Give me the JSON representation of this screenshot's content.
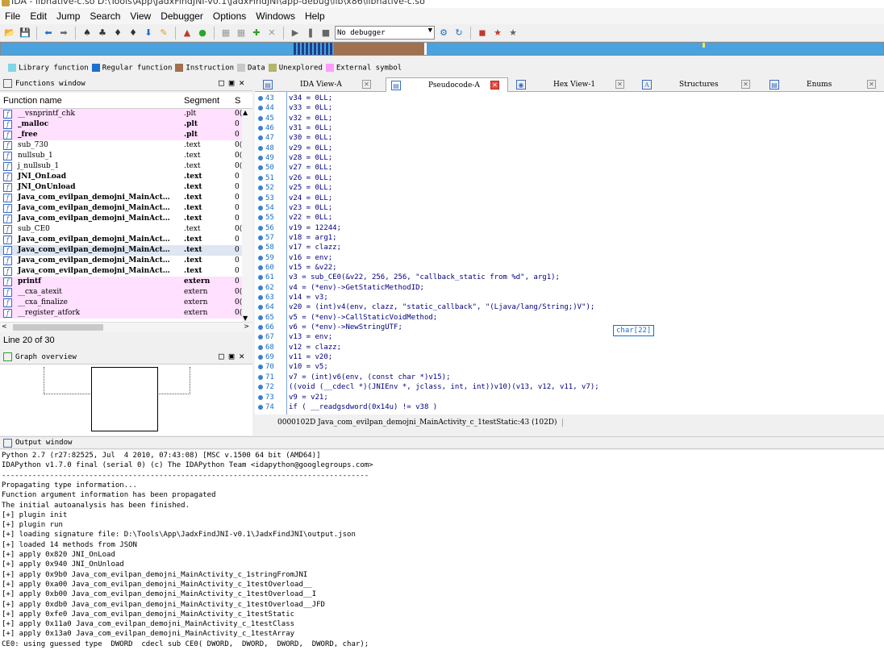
{
  "window": {
    "title": "IDA - libnative-c.so D:\\Tools\\App\\JadxFindJNI-v0.1\\JadxFindJNI\\app-debug\\lib\\x86\\libnative-c.so"
  },
  "menu": [
    "File",
    "Edit",
    "Jump",
    "Search",
    "View",
    "Debugger",
    "Options",
    "Windows",
    "Help"
  ],
  "toolbar": {
    "debugger_select": "No debugger"
  },
  "legend": [
    {
      "label": "Library function",
      "color": "#7fd6e6"
    },
    {
      "label": "Regular function",
      "color": "#1f6fd1"
    },
    {
      "label": "Instruction",
      "color": "#a0704f"
    },
    {
      "label": "Data",
      "color": "#c8c8c8"
    },
    {
      "label": "Unexplored",
      "color": "#b5b56b"
    },
    {
      "label": "External symbol",
      "color": "#ff9cff"
    }
  ],
  "functions_window": {
    "title": "Functions window",
    "col_name": "Function name",
    "col_segment": "Segment",
    "col_s": "S",
    "line_label": "Line 20 of 30",
    "rows": [
      {
        "name": "__vsnprintf_chk",
        "segment": ".plt",
        "s": "0(",
        "style": "pink"
      },
      {
        "name": "_malloc",
        "segment": ".plt",
        "s": "0",
        "style": "pink bold"
      },
      {
        "name": "_free",
        "segment": ".plt",
        "s": "0",
        "style": "pink bold"
      },
      {
        "name": "sub_730",
        "segment": ".text",
        "s": "0(",
        "style": ""
      },
      {
        "name": "nullsub_1",
        "segment": ".text",
        "s": "0(",
        "style": ""
      },
      {
        "name": "j_nullsub_1",
        "segment": ".text",
        "s": "0(",
        "style": ""
      },
      {
        "name": "JNI_OnLoad",
        "segment": ".text",
        "s": "0",
        "style": "bold"
      },
      {
        "name": "JNI_OnUnload",
        "segment": ".text",
        "s": "0",
        "style": "bold"
      },
      {
        "name": "Java_com_evilpan_demojni_MainAct…",
        "segment": ".text",
        "s": "0",
        "style": "bold"
      },
      {
        "name": "Java_com_evilpan_demojni_MainAct…",
        "segment": ".text",
        "s": "0",
        "style": "bold"
      },
      {
        "name": "Java_com_evilpan_demojni_MainAct…",
        "segment": ".text",
        "s": "0",
        "style": "bold"
      },
      {
        "name": "sub_CE0",
        "segment": ".text",
        "s": "0(",
        "style": ""
      },
      {
        "name": "Java_com_evilpan_demojni_MainAct…",
        "segment": ".text",
        "s": "0",
        "style": "bold"
      },
      {
        "name": "Java_com_evilpan_demojni_MainAct…",
        "segment": ".text",
        "s": "0",
        "style": "bold sel"
      },
      {
        "name": "Java_com_evilpan_demojni_MainAct…",
        "segment": ".text",
        "s": "0",
        "style": "bold"
      },
      {
        "name": "Java_com_evilpan_demojni_MainAct…",
        "segment": ".text",
        "s": "0",
        "style": "bold"
      },
      {
        "name": "printf",
        "segment": "extern",
        "s": "0",
        "style": "pink bold"
      },
      {
        "name": "__cxa_atexit",
        "segment": "extern",
        "s": "0(",
        "style": "pink"
      },
      {
        "name": "__cxa_finalize",
        "segment": "extern",
        "s": "0(",
        "style": "pink"
      },
      {
        "name": "__register_atfork",
        "segment": "extern",
        "s": "0(",
        "style": "pink"
      }
    ]
  },
  "graph_overview": {
    "title": "Graph overview"
  },
  "tabs": [
    {
      "label": "IDA View-A",
      "active": false,
      "close": "normal"
    },
    {
      "label": "Pseudocode-A",
      "active": true,
      "close": "red"
    },
    {
      "label": "Hex View-1",
      "active": false,
      "close": "normal"
    },
    {
      "label": "Structures",
      "active": false,
      "close": "normal"
    },
    {
      "label": "Enums",
      "active": false,
      "close": "normal"
    }
  ],
  "code_lines": [
    {
      "n": "43",
      "t": "v34 = 0LL;"
    },
    {
      "n": "44",
      "t": "v33 = 0LL;"
    },
    {
      "n": "45",
      "t": "v32 = 0LL;"
    },
    {
      "n": "46",
      "t": "v31 = 0LL;"
    },
    {
      "n": "47",
      "t": "v30 = 0LL;"
    },
    {
      "n": "48",
      "t": "v29 = 0LL;"
    },
    {
      "n": "49",
      "t": "v28 = 0LL;"
    },
    {
      "n": "50",
      "t": "v27 = 0LL;"
    },
    {
      "n": "51",
      "t": "v26 = 0LL;"
    },
    {
      "n": "52",
      "t": "v25 = 0LL;"
    },
    {
      "n": "53",
      "t": "v24 = 0LL;"
    },
    {
      "n": "54",
      "t": "v23 = 0LL;"
    },
    {
      "n": "55",
      "t": "v22 = 0LL;"
    },
    {
      "n": "56",
      "t": "v19 = 12244;"
    },
    {
      "n": "57",
      "t": "v18 = arg1;"
    },
    {
      "n": "58",
      "t": "v17 = clazz;"
    },
    {
      "n": "59",
      "t": "v16 = env;"
    },
    {
      "n": "60",
      "t": "v15 = &v22;"
    },
    {
      "n": "61",
      "t": "v3 = sub_CE0(&v22, 256, 256, \"callback_static from %d\", arg1);"
    },
    {
      "n": "62",
      "t": "v4 = (*env)->GetStaticMethodID;"
    },
    {
      "n": "63",
      "t": "v14 = v3;"
    },
    {
      "n": "64",
      "t": "v20 = (int)v4(env, clazz, \"static_callback\", \"(Ljava/lang/String;)V\");"
    },
    {
      "n": "65",
      "t": "v5 = (*env)->CallStaticVoidMethod;"
    },
    {
      "n": "66",
      "t": "v6 = (*env)->NewStringUTF;"
    },
    {
      "n": "67",
      "t": "v13 = env;"
    },
    {
      "n": "68",
      "t": "v12 = clazz;"
    },
    {
      "n": "69",
      "t": "v11 = v20;"
    },
    {
      "n": "70",
      "t": "v10 = v5;"
    },
    {
      "n": "71",
      "t": "v7 = (int)v6(env, (const char *)v15);"
    },
    {
      "n": "72",
      "t": "((void (__cdecl *)(JNIEnv *, jclass, int, int))v10)(v13, v12, v11, v7);"
    },
    {
      "n": "73",
      "t": "v9 = v21;"
    },
    {
      "n": "74",
      "t": "if ( __readgsdword(0x14u) != v38 )"
    }
  ],
  "hint_box": "char[22]",
  "status_line": "0000102D Java_com_evilpan_demojni_MainActivity_c_1testStatic:43 (102D)",
  "output_window": {
    "title": "Output window",
    "lines": [
      "Python 2.7 (r27:82525, Jul  4 2010, 07:43:08) [MSC v.1500 64 bit (AMD64)]",
      "IDAPython v1.7.0 final (serial 0) (c) The IDAPython Team <idapython@googlegroups.com>",
      "------------------------------------------------------------------------------------",
      "Propagating type information...",
      "Function argument information has been propagated",
      "The initial autoanalysis has been finished.",
      "[+] plugin init",
      "[+] plugin run",
      "[+] loading signature file: D:\\Tools\\App\\JadxFindJNI-v0.1\\JadxFindJNI\\output.json",
      "[+] loaded 14 methods from JSON",
      "[+] apply 0x820 JNI_OnLoad",
      "[+] apply 0x940 JNI_OnUnload",
      "[+] apply 0x9b0 Java_com_evilpan_demojni_MainActivity_c_1stringFromJNI",
      "[+] apply 0xa00 Java_com_evilpan_demojni_MainActivity_c_1testOverload__",
      "[+] apply 0xb00 Java_com_evilpan_demojni_MainActivity_c_1testOverload__I",
      "[+] apply 0xdb0 Java_com_evilpan_demojni_MainActivity_c_1testOverload__JFD",
      "[+] apply 0xfe0 Java_com_evilpan_demojni_MainActivity_c_1testStatic",
      "[+] apply 0x11a0 Java_com_evilpan_demojni_MainActivity_c_1testClass",
      "[+] apply 0x13a0 Java_com_evilpan_demojni_MainActivity_c_1testArray",
      "CE0: using guessed type  DWORD  cdecl sub CE0( DWORD,  DWORD,  DWORD,  DWORD, char);"
    ]
  }
}
